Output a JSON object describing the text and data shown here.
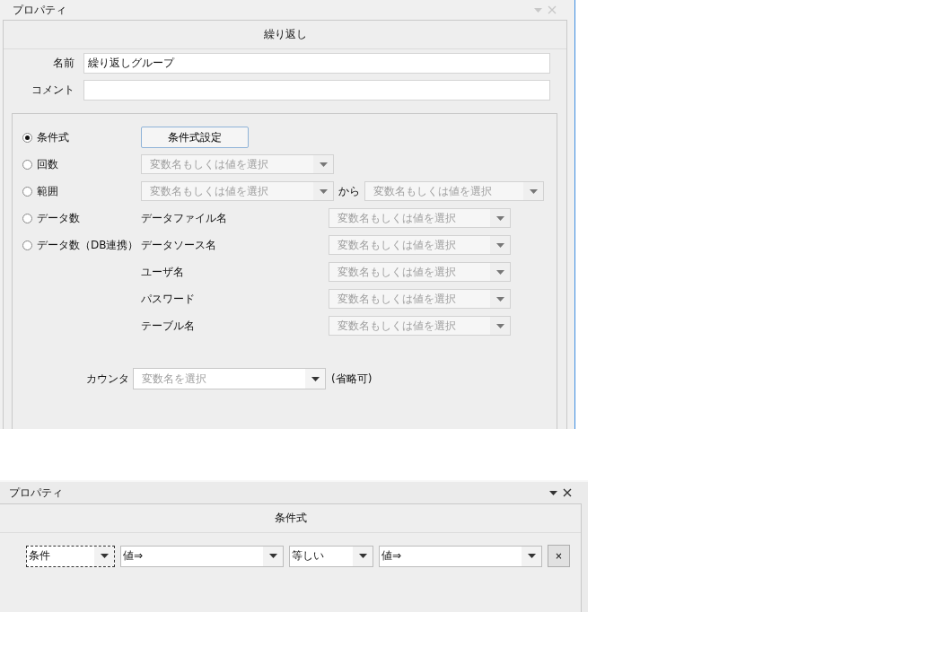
{
  "repeat_panel": {
    "title": "プロパティ",
    "active": false,
    "header": "繰り返し",
    "fields": [
      {
        "label": "名前",
        "value": "繰り返しグループ"
      },
      {
        "label": "コメント"
      }
    ],
    "rows": [
      {
        "kind": "button",
        "option": {
          "label": "条件式",
          "selected": true
        },
        "button": "条件式設定"
      },
      {
        "kind": "combo",
        "option": {
          "label": "回数",
          "selected": false
        },
        "combo": {
          "placeholder": "変数名もしくは値を選択",
          "disabled": true
        }
      },
      {
        "kind": "range",
        "option": {
          "label": "範囲",
          "selected": false
        },
        "from": {
          "placeholder": "変数名もしくは値を選択",
          "disabled": true
        },
        "joiner": "から",
        "to": {
          "placeholder": "変数名もしくは値を選択",
          "disabled": true
        }
      },
      {
        "kind": "labeled_combo",
        "option": {
          "label": "データ数",
          "selected": false
        },
        "label": "データファイル名",
        "combo": {
          "placeholder": "変数名もしくは値を選択",
          "disabled": true
        }
      },
      {
        "kind": "labeled_combo",
        "option": {
          "label": "データ数（DB連携）",
          "selected": false
        },
        "label": "データソース名",
        "combo": {
          "placeholder": "変数名もしくは値を選択",
          "disabled": true
        }
      },
      {
        "kind": "labeled_combo",
        "label": "ユーザ名",
        "combo": {
          "placeholder": "変数名もしくは値を選択",
          "disabled": true
        }
      },
      {
        "kind": "labeled_combo",
        "label": "パスワード",
        "combo": {
          "placeholder": "変数名もしくは値を選択",
          "disabled": true
        }
      },
      {
        "kind": "labeled_combo",
        "label": "テーブル名",
        "combo": {
          "placeholder": "変数名もしくは値を選択",
          "disabled": true
        }
      }
    ],
    "counter": {
      "label": "カウンタ",
      "combo": {
        "placeholder": "変数名を選択",
        "disabled": false
      },
      "note": "(省略可)"
    }
  },
  "condition_panel": {
    "title": "プロパティ",
    "active": true,
    "header": "条件式",
    "condition": [
      {
        "kind": "subject",
        "value": "条件",
        "focused": true
      },
      {
        "kind": "operand",
        "value": "値⇒",
        "focused": false
      },
      {
        "kind": "operator",
        "value": "等しい",
        "focused": false
      },
      {
        "kind": "operand",
        "value": "値⇒",
        "focused": false
      }
    ],
    "remove_button": "×"
  }
}
